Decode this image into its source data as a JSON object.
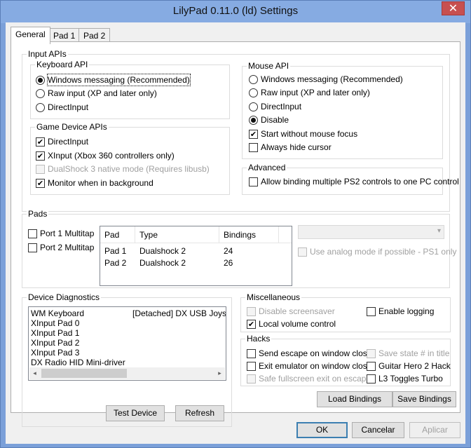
{
  "window": {
    "title": "LilyPad 0.11.0 (ld) Settings",
    "close_glyph": "✕"
  },
  "tabs": [
    {
      "label": "General",
      "active": true
    },
    {
      "label": "Pad 1",
      "active": false
    },
    {
      "label": "Pad 2",
      "active": false
    }
  ],
  "input_apis": {
    "legend": "Input APIs",
    "keyboard": {
      "legend": "Keyboard API",
      "options": [
        {
          "label": "Windows messaging (Recommended)",
          "selected": true
        },
        {
          "label": "Raw input (XP and later only)",
          "selected": false
        },
        {
          "label": "DirectInput",
          "selected": false
        }
      ]
    },
    "game_device": {
      "legend": "Game Device APIs",
      "options": [
        {
          "label": "DirectInput",
          "checked": true,
          "enabled": true
        },
        {
          "label": "XInput (Xbox 360 controllers only)",
          "checked": true,
          "enabled": true
        },
        {
          "label": "DualShock 3 native mode (Requires libusb)",
          "checked": false,
          "enabled": false
        },
        {
          "label": "Monitor when in background",
          "checked": true,
          "enabled": true
        }
      ]
    },
    "mouse": {
      "legend": "Mouse API",
      "options": [
        {
          "label": "Windows messaging (Recommended)",
          "selected": false
        },
        {
          "label": "Raw input (XP and later only)",
          "selected": false
        },
        {
          "label": "DirectInput",
          "selected": false
        },
        {
          "label": "Disable",
          "selected": true
        }
      ],
      "checks": [
        {
          "label": "Start without mouse focus",
          "checked": true
        },
        {
          "label": "Always hide cursor",
          "checked": false
        }
      ]
    },
    "advanced": {
      "legend": "Advanced",
      "option": {
        "label": "Allow binding multiple PS2 controls to one PC control",
        "checked": false
      }
    }
  },
  "pads": {
    "legend": "Pads",
    "multitaps": [
      {
        "label": "Port 1 Multitap",
        "checked": false
      },
      {
        "label": "Port 2 Multitap",
        "checked": false
      }
    ],
    "table": {
      "headers": [
        "Pad",
        "Type",
        "Bindings"
      ],
      "rows": [
        [
          "Pad 1",
          "Dualshock 2",
          "24"
        ],
        [
          "Pad 2",
          "Dualshock 2",
          "26"
        ]
      ]
    },
    "type_select": {
      "value": ""
    },
    "analog_option": {
      "label": "Use analog mode if possible - PS1 only",
      "checked": false,
      "enabled": false
    }
  },
  "diagnostics": {
    "legend": "Device Diagnostics",
    "devices": [
      "WM Keyboard",
      "XInput Pad 0",
      "XInput Pad 1",
      "XInput Pad 2",
      "XInput Pad 3",
      "DX Radio HID Mini-driver"
    ],
    "second_column_item": "[Detached] DX USB Joystick",
    "test_button": "Test Device",
    "refresh_button": "Refresh"
  },
  "misc": {
    "legend": "Miscellaneous",
    "options": [
      {
        "label": "Disable screensaver",
        "checked": false,
        "enabled": false
      },
      {
        "label": "Enable logging",
        "checked": false,
        "enabled": true
      },
      {
        "label": "Local volume control",
        "checked": true,
        "enabled": true
      }
    ]
  },
  "hacks": {
    "legend": "Hacks",
    "options": [
      {
        "label": "Send escape on window close",
        "checked": false,
        "enabled": true
      },
      {
        "label": "Save state # in title",
        "checked": false,
        "enabled": false
      },
      {
        "label": "Exit emulator on window close",
        "checked": false,
        "enabled": true
      },
      {
        "label": "Guitar Hero 2 Hack",
        "checked": false,
        "enabled": true
      },
      {
        "label": "Safe fullscreen exit on escape",
        "checked": false,
        "enabled": false
      },
      {
        "label": "L3 Toggles Turbo",
        "checked": false,
        "enabled": true
      }
    ]
  },
  "bindings_buttons": {
    "load": "Load Bindings",
    "save": "Save Bindings"
  },
  "dialog_buttons": {
    "ok": "OK",
    "cancel": "Cancelar",
    "apply": "Aplicar"
  },
  "glyphs": {
    "check": "✔",
    "combo_arrow": "▾",
    "scroll_left": "◂",
    "scroll_right": "▸"
  }
}
